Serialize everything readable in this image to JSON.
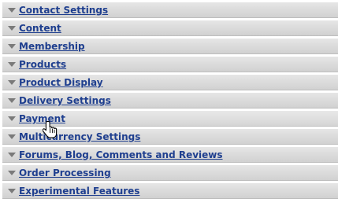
{
  "sections": [
    {
      "label": "Contact Settings"
    },
    {
      "label": "Content"
    },
    {
      "label": "Membership"
    },
    {
      "label": "Products"
    },
    {
      "label": "Product Display"
    },
    {
      "label": "Delivery Settings"
    },
    {
      "label": "Payment"
    },
    {
      "label": "Multicurrency Settings"
    },
    {
      "label": "Forums, Blog, Comments and Reviews"
    },
    {
      "label": "Order Processing"
    },
    {
      "label": "Experimental Features"
    }
  ],
  "cursor": {
    "icon": "hand-pointer-icon"
  },
  "colors": {
    "link": "#1f3f8f",
    "header_bg": "#dadada",
    "arrow": "#7a7a7a"
  }
}
